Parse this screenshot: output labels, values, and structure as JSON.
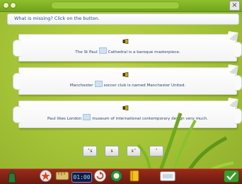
{
  "window": {
    "close_label": "×"
  },
  "instruction": "What is missing? Click on the button.",
  "cards": [
    {
      "before": "The St Paul",
      "after": "Cathedral is a baroque masterpiece."
    },
    {
      "before": "Manchester",
      "after": "soccer club is named Manchester United."
    },
    {
      "before": "Paul likes London",
      "after": "museum of international contemporary design very much."
    }
  ],
  "answers": [
    "’s",
    "s",
    "s’",
    "’"
  ],
  "timer": "01:00",
  "colors": {
    "background": "#a8c63a",
    "toolbar": "#8a2417",
    "text": "#2c4470"
  }
}
